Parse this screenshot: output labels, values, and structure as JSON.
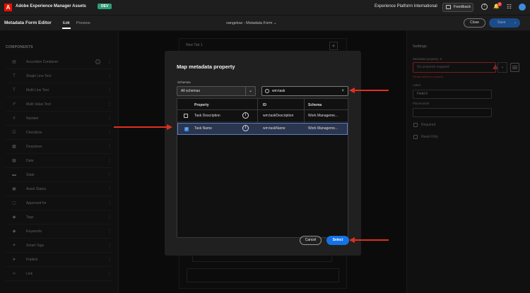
{
  "topbar": {
    "logo_glyph": "A",
    "app_name": "Adobe Experience Manager Assets",
    "env_badge": "DEV",
    "org_name": "Experience Platform International",
    "feedback_label": "Feedback",
    "help_icon": "?",
    "notification_count": "7",
    "avatar_icon": "avatar"
  },
  "editor": {
    "title": "Metadata Form Editor",
    "tabs": [
      {
        "label": "Edit"
      },
      {
        "label": "Preview"
      }
    ],
    "form_name": "vangeluw - Metadata Form",
    "close_label": "Close",
    "save_label": "Save"
  },
  "components": {
    "title": "COMPONENTS",
    "items": [
      {
        "label": "Accordion Container",
        "icon": "accordion-icon"
      },
      {
        "label": "Single Line Text",
        "icon": "text-icon"
      },
      {
        "label": "Multi Line Text",
        "icon": "text-icon"
      },
      {
        "label": "Multi Value Text",
        "icon": "multi-value-icon"
      },
      {
        "label": "Number",
        "icon": "number-icon"
      },
      {
        "label": "Checkbox",
        "icon": "checkbox-icon"
      },
      {
        "label": "Dropdown",
        "icon": "dropdown-icon"
      },
      {
        "label": "Date",
        "icon": "date-icon"
      },
      {
        "label": "State",
        "icon": "state-icon"
      },
      {
        "label": "Asset Status",
        "icon": "asset-status-icon"
      },
      {
        "label": "Approved for",
        "icon": "approved-icon"
      },
      {
        "label": "Tags",
        "icon": "tag-icon"
      },
      {
        "label": "Keywords",
        "icon": "keyword-icon"
      },
      {
        "label": "Smart Tags",
        "icon": "smart-tag-icon"
      },
      {
        "label": "Publish",
        "icon": "publish-icon"
      },
      {
        "label": "Link",
        "icon": "link-icon"
      }
    ]
  },
  "canvas": {
    "tab_label": "New Tab 1"
  },
  "settings": {
    "title": "Settings",
    "metadata_property_label": "Metadata property",
    "metadata_property_placeholder": "No property mapped",
    "error_text": "Please select a property",
    "label_label": "Label",
    "label_value": "Field 6",
    "placeholder_label": "Placeholder",
    "required_label": "Required",
    "readonly_label": "Read-Only"
  },
  "modal": {
    "title": "Map metadata property",
    "schemas_label": "Schemas",
    "schema_selected": "All schemas",
    "search_value": "wm:task",
    "columns": [
      "Property",
      "ID",
      "Schema"
    ],
    "rows": [
      {
        "property": "Task Description",
        "id": "wm:taskDescription",
        "schema": "Work Manageme...",
        "checked": false
      },
      {
        "property": "Task Name",
        "id": "wm:taskName",
        "schema": "Work Manageme...",
        "checked": true
      }
    ],
    "cancel_label": "Cancel",
    "select_label": "Select"
  },
  "colors": {
    "accent": "#1473e6",
    "annotation_arrow": "#e0301e",
    "error": "#e34850",
    "env_badge": "#2d9d78"
  }
}
